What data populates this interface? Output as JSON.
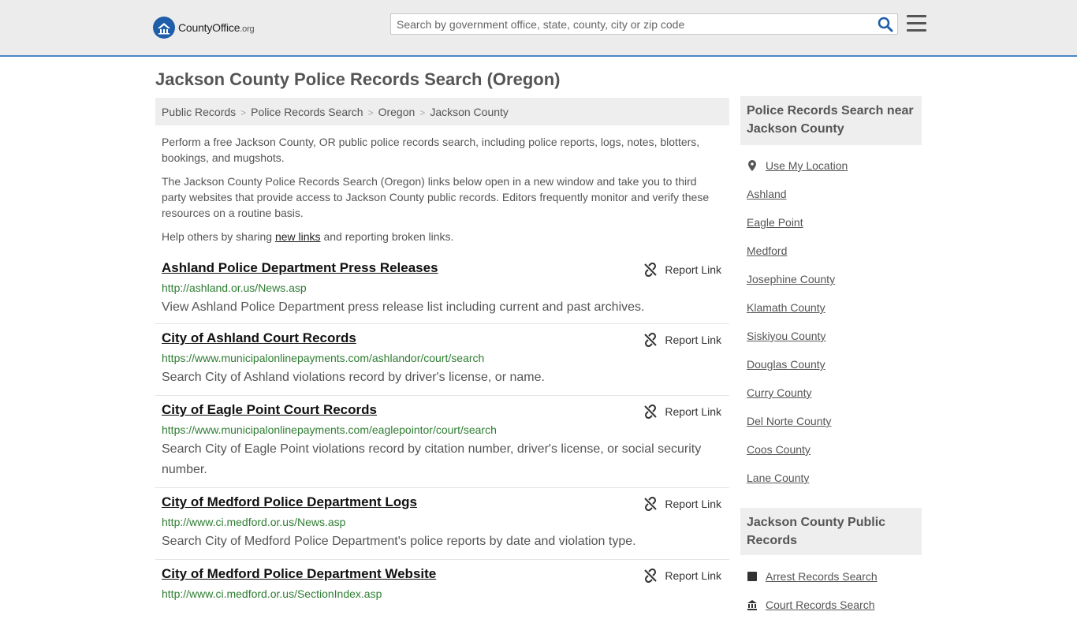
{
  "header": {
    "logo_name": "County",
    "logo_office": "Office",
    "logo_org": ".org",
    "search_placeholder": "Search by government office, state, county, city or zip code"
  },
  "page": {
    "title": "Jackson County Police Records Search (Oregon)",
    "breadcrumb": [
      "Public Records",
      "Police Records Search",
      "Oregon",
      "Jackson County"
    ],
    "intro1": "Perform a free Jackson County, OR public police records search, including police reports, logs, notes, blotters, bookings, and mugshots.",
    "intro2": "The Jackson County Police Records Search (Oregon) links below open in a new window and take you to third party websites that provide access to Jackson County public records. Editors frequently monitor and verify these resources on a routine basis.",
    "intro3_before": "Help others by sharing ",
    "intro3_link": "new links",
    "intro3_after": " and reporting broken links."
  },
  "listings": [
    {
      "title": "Ashland Police Department Press Releases",
      "url": "http://ashland.or.us/News.asp",
      "desc": "View Ashland Police Department press release list including current and past archives.",
      "report": "Report Link"
    },
    {
      "title": "City of Ashland Court Records",
      "url": "https://www.municipalonlinepayments.com/ashlandor/court/search",
      "desc": "Search City of Ashland violations record by driver's license, or name.",
      "report": "Report Link"
    },
    {
      "title": "City of Eagle Point Court Records",
      "url": "https://www.municipalonlinepayments.com/eaglepointor/court/search",
      "desc": "Search City of Eagle Point violations record by citation number, driver's license, or social security number.",
      "report": "Report Link"
    },
    {
      "title": "City of Medford Police Department Logs",
      "url": "http://www.ci.medford.or.us/News.asp",
      "desc": "Search City of Medford Police Department's police reports by date and violation type.",
      "report": "Report Link"
    },
    {
      "title": "City of Medford Police Department Website",
      "url": "http://www.ci.medford.or.us/SectionIndex.asp",
      "desc": "",
      "report": "Report Link"
    }
  ],
  "sidebar": {
    "nearby_heading": "Police Records Search near Jackson County",
    "use_location": "Use My Location",
    "nearby": [
      "Ashland",
      "Eagle Point",
      "Medford",
      "Josephine County",
      "Klamath County",
      "Siskiyou County",
      "Douglas County",
      "Curry County",
      "Del Norte County",
      "Coos County",
      "Lane County"
    ],
    "public_heading": "Jackson County Public Records",
    "public_links": [
      "Arrest Records Search",
      "Court Records Search"
    ]
  },
  "colors": {
    "accent_blue": "#4a86c5",
    "link_green": "#2e7d32",
    "header_bg": "#ececec"
  }
}
